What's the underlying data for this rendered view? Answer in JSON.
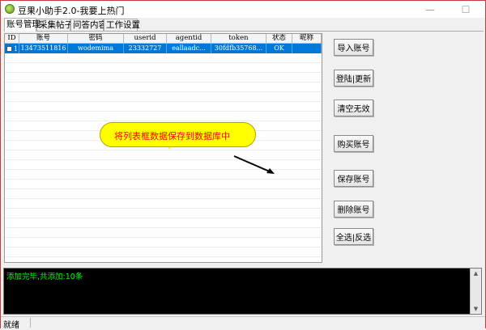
{
  "window": {
    "title": "豆果小助手2.0-我要上热门",
    "minimize_glyph": "—",
    "maximize_glyph": "☐"
  },
  "tabs": [
    {
      "label": "账号管理",
      "active": true
    },
    {
      "label": "采集帖子",
      "active": false
    },
    {
      "label": "问答内容",
      "active": false
    },
    {
      "label": "工作设置",
      "active": false
    }
  ],
  "grid": {
    "columns": [
      "ID",
      "账号",
      "密码",
      "userid",
      "agentid",
      "token",
      "状态",
      "昵称"
    ],
    "rows": [
      {
        "id": "1",
        "account": "13473511816",
        "password": "wodemima",
        "userid": "23332727",
        "agentid": "eallaadc...",
        "token": "30fdfb35768...",
        "status": "OK",
        "nickname": ""
      }
    ]
  },
  "callout": {
    "text": "将列表框数据保存到数据库中",
    "fill": "#ffff00",
    "text_color": "#ff0000"
  },
  "buttons": {
    "import": "导入账号",
    "login_refresh": "登陆|更新",
    "clear_invalid": "清空无效",
    "buy": "购买账号",
    "save": "保存账号",
    "delete": "删除账号",
    "select_all_invert": "全选|反选"
  },
  "log": {
    "text": "添加完毕,共添加:10条",
    "text_color": "#00ff00",
    "up_glyph": "▲",
    "down_glyph": "▼"
  },
  "status_bar": {
    "text": "就绪"
  },
  "colors": {
    "selection": "#0078d7",
    "window_border": "#c53a3a"
  }
}
